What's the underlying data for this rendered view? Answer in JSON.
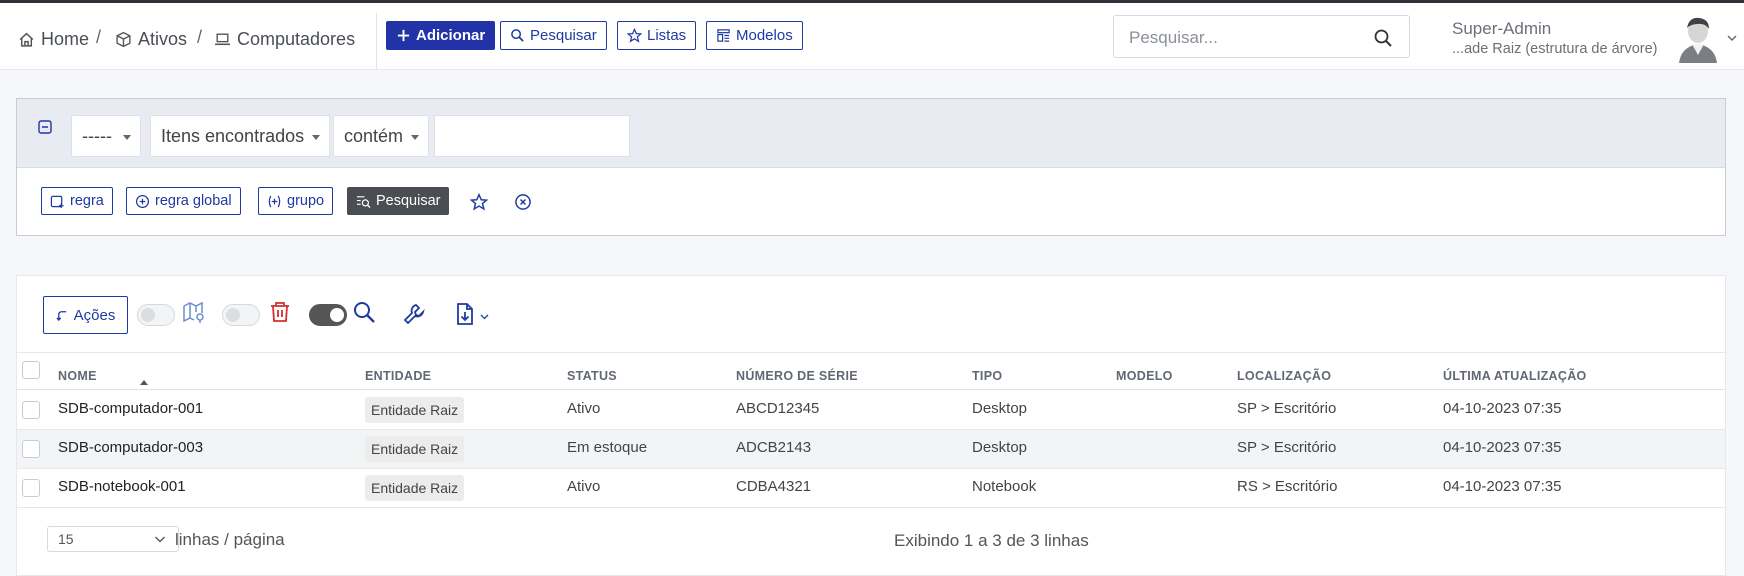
{
  "breadcrumb": {
    "items": [
      {
        "label": "Home",
        "icon": "home-icon"
      },
      {
        "label": "Ativos",
        "icon": "box-icon"
      },
      {
        "label": "Computadores",
        "icon": "laptop-icon"
      }
    ],
    "separator": "/"
  },
  "toolbar": {
    "add_label": "Adicionar",
    "search_label": "Pesquisar",
    "lists_label": "Listas",
    "models_label": "Modelos"
  },
  "search": {
    "placeholder": "Pesquisar..."
  },
  "user": {
    "name": "Super-Admin",
    "entity": "...ade Raiz (estrutura de árvore)"
  },
  "filter": {
    "field_select": "-----",
    "criteria_select": "Itens encontrados",
    "operator_select": "contém",
    "value": "",
    "buttons": {
      "rule": "regra",
      "global_rule": "regra global",
      "group": "grupo",
      "search": "Pesquisar"
    }
  },
  "actions": {
    "label": "Ações"
  },
  "table": {
    "columns": [
      "NOME",
      "ENTIDADE",
      "STATUS",
      "NÚMERO DE SÉRIE",
      "TIPO",
      "MODELO",
      "LOCALIZAÇÃO",
      "ÚLTIMA ATUALIZAÇÃO"
    ],
    "sorted_column": "NOME",
    "rows": [
      {
        "name": "SDB-computador-001",
        "entity": "Entidade Raiz",
        "status": "Ativo",
        "serial": "ABCD12345",
        "type": "Desktop",
        "model": "",
        "location": "SP > Escritório",
        "updated": "04-10-2023 07:35"
      },
      {
        "name": "SDB-computador-003",
        "entity": "Entidade Raiz",
        "status": "Em estoque",
        "serial": "ADCB2143",
        "type": "Desktop",
        "model": "",
        "location": "SP > Escritório",
        "updated": "04-10-2023 07:35"
      },
      {
        "name": "SDB-notebook-001",
        "entity": "Entidade Raiz",
        "status": "Ativo",
        "serial": "CDBA4321",
        "type": "Notebook",
        "model": "",
        "location": "RS > Escritório",
        "updated": "04-10-2023 07:35"
      }
    ]
  },
  "pagination": {
    "per_page": "15",
    "per_page_label": "linhas / página",
    "info": "Exibindo 1 a 3 de 3 linhas"
  },
  "colors": {
    "primary": "#2233a8",
    "outline": "#1f3aa0",
    "danger": "#d32f2f",
    "filter_bg": "#e9ebf2"
  }
}
